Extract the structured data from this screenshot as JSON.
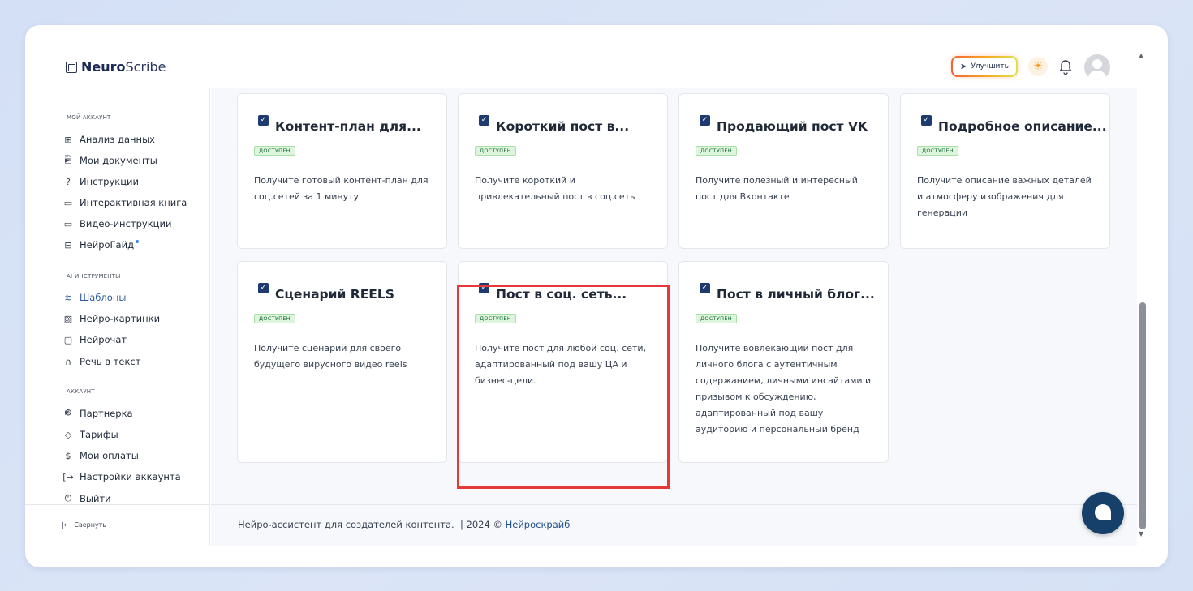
{
  "header": {
    "logo_bold": "Neuro",
    "logo_light": "Scribe",
    "upgrade_label": "Улучшить"
  },
  "sidebar": {
    "sections": [
      {
        "title": "МОЙ АККАУНТ",
        "items": [
          {
            "label": "Анализ данных",
            "icon": "grid-icon"
          },
          {
            "label": "Мои документы",
            "icon": "document-icon"
          },
          {
            "label": "Инструкции",
            "icon": "help-circle-icon"
          },
          {
            "label": "Интерактивная книга",
            "icon": "book-icon"
          },
          {
            "label": "Видео-инструкции",
            "icon": "video-icon"
          },
          {
            "label": "НейроГайд",
            "icon": "layout-icon"
          }
        ]
      },
      {
        "title": "AI-ИНСТРУМЕНТЫ",
        "items": [
          {
            "label": "Шаблоны",
            "icon": "layers-icon"
          },
          {
            "label": "Нейро-картинки",
            "icon": "image-icon"
          },
          {
            "label": "Нейрочат",
            "icon": "message-icon"
          },
          {
            "label": "Речь в текст",
            "icon": "headphones-icon"
          }
        ]
      },
      {
        "title": "АККАУНТ",
        "items": [
          {
            "label": "Партнерка",
            "icon": "users-icon"
          },
          {
            "label": "Тарифы",
            "icon": "tag-icon"
          },
          {
            "label": "Мои оплаты",
            "icon": "dollar-icon"
          },
          {
            "label": "Настройки аккаунта",
            "icon": "login-icon"
          },
          {
            "label": "Выйти",
            "icon": "power-icon"
          }
        ]
      }
    ],
    "collapse_label": "Свернуть"
  },
  "cards": [
    {
      "title": "Контент-план для...",
      "badge": "ДОСТУПЕН",
      "desc": "Получите готовый контент-план для соц.сетей за 1 минуту"
    },
    {
      "title": "Короткий пост в...",
      "badge": "ДОСТУПЕН",
      "desc": "Получите короткий и привлекательный пост в соц.сеть"
    },
    {
      "title": "Продающий пост VK",
      "badge": "ДОСТУПЕН",
      "desc": "Получите полезный и интересный пост для Вконтакте"
    },
    {
      "title": "Подробное описание...",
      "badge": "ДОСТУПЕН",
      "desc": "Получите описание важных деталей и атмосферу изображения для генерации"
    },
    {
      "title": "Сценарий REELS",
      "badge": "ДОСТУПЕН",
      "desc": "Получите сценарий для своего будущего вирусного видео reels"
    },
    {
      "title": "Пост в соц. сеть...",
      "badge": "ДОСТУПЕН",
      "desc": "Получите пост для любой соц. сети, адаптированный под вашу ЦА и бизнес-цели."
    },
    {
      "title": "Пост в личный блог...",
      "badge": "ДОСТУПЕН",
      "desc": "Получите вовлекающий пост для личного блога с аутентичным содержанием, личными инсайтами и призывом к обсуждению, адаптированный под вашу аудиторию и персональный бренд"
    }
  ],
  "footer": {
    "text": "Нейро-ассистент для создателей контента.  | 2024 © ",
    "link": "Нейроскрайб"
  }
}
